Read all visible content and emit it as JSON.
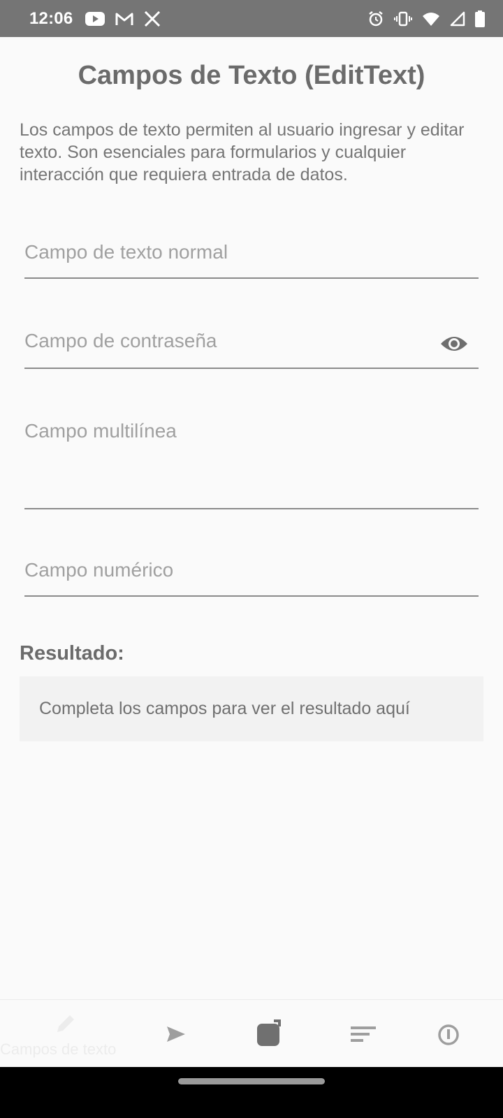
{
  "status_bar": {
    "time": "12:06",
    "left_icons": [
      "youtube-icon",
      "gmail-icon",
      "x-icon"
    ],
    "right_icons": [
      "alarm-icon",
      "vibrate-icon",
      "wifi-icon",
      "signal-icon",
      "battery-icon"
    ]
  },
  "page": {
    "title": "Campos de Texto (EditText)",
    "description": "Los campos de texto permiten al usuario ingresar y editar texto. Son esenciales para formularios y cualquier interacción que requiera entrada de datos."
  },
  "fields": [
    {
      "placeholder": "Campo de texto normal",
      "value": ""
    },
    {
      "placeholder": "Campo de contraseña",
      "value": "",
      "toggle_icon": "eye-icon"
    },
    {
      "placeholder": "Campo multilínea",
      "value": ""
    },
    {
      "placeholder": "Campo numérico",
      "value": ""
    }
  ],
  "result": {
    "label": "Resultado:",
    "text": "Completa los campos para ver el resultado aquí"
  },
  "bottom_nav": {
    "items": [
      {
        "icon": "pencil-icon",
        "label": "Campos de texto",
        "selected": true
      },
      {
        "icon": "send-icon"
      },
      {
        "icon": "checkbox-icon"
      },
      {
        "icon": "sort-icon"
      },
      {
        "icon": "toggle-icon"
      }
    ]
  },
  "colors": {
    "status_bar": "#757575",
    "background": "#fafafa",
    "title": "#6b6b6b",
    "placeholder": "#a0a0a0",
    "underline": "#8a8a8a",
    "result_box": "#f2f2f2"
  }
}
